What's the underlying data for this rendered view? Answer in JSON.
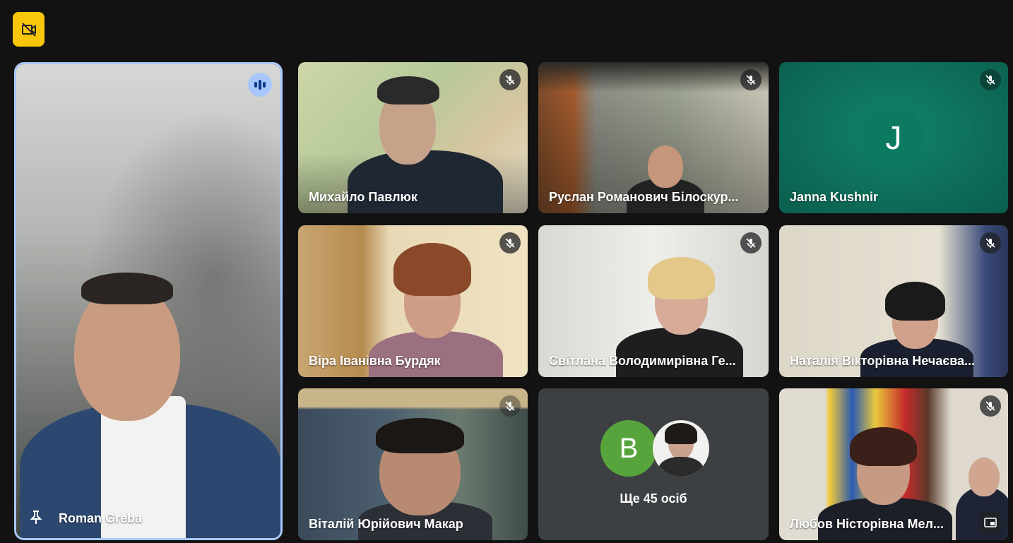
{
  "toolbar": {
    "icon": "video-off-icon",
    "accent": "#f9c60b"
  },
  "main_speaker": {
    "name": "Roman Greba",
    "speaking": true,
    "pin_icon": "pin-icon",
    "speaking_icon": "audio-wave-icon"
  },
  "participants": [
    {
      "name": "Михайло Павлюк",
      "muted": true
    },
    {
      "name": "Руслан Романович Білоскур...",
      "muted": true
    },
    {
      "name": "Janna Kushnir",
      "muted": true,
      "avatar_letter": "J",
      "avatar_color": "#0b7a61"
    },
    {
      "name": "Віра Іванівна Бурдяк",
      "muted": true
    },
    {
      "name": "Світлана Володимирівна Ге...",
      "muted": true
    },
    {
      "name": "Наталія Вікторівна Нечаєва...",
      "muted": true
    },
    {
      "name": "Віталій Юрійович Макар",
      "muted": true
    },
    {
      "name": "Любов Ністорівна Мел...",
      "muted": true
    }
  ],
  "more": {
    "label": "Ще 45 осіб",
    "avatar_letter": "B",
    "avatar_color": "#58a43c"
  }
}
